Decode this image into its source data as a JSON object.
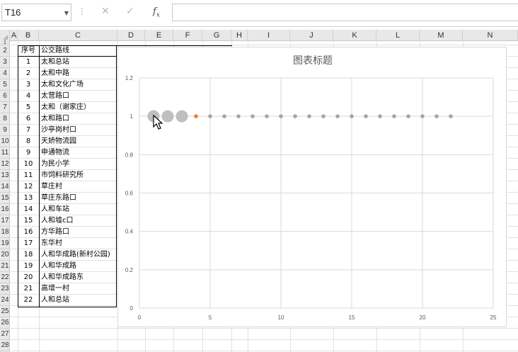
{
  "formula_bar": {
    "name_box": "T16",
    "cancel_icon": "✕",
    "enter_icon": "✓",
    "fx_label": "f",
    "fx_sub": "x",
    "formula": ""
  },
  "columns": [
    "A",
    "B",
    "C",
    "D",
    "E",
    "F",
    "G",
    "H",
    "I",
    "J",
    "K",
    "L",
    "M",
    "N"
  ],
  "rows": [
    "1",
    "2",
    "3",
    "4",
    "5",
    "6",
    "7",
    "8",
    "9",
    "10",
    "11",
    "12",
    "13",
    "14",
    "15",
    "16",
    "17",
    "18",
    "19",
    "20",
    "21",
    "22",
    "23",
    "24",
    "25",
    "26",
    "27",
    "28"
  ],
  "table": {
    "header": {
      "num": "序号",
      "name": "公交路线"
    },
    "rows": [
      {
        "num": "1",
        "name": "太和总站"
      },
      {
        "num": "2",
        "name": "太和中路"
      },
      {
        "num": "3",
        "name": "太和文化广场"
      },
      {
        "num": "4",
        "name": "太营路口"
      },
      {
        "num": "5",
        "name": "太和（谢家庄）"
      },
      {
        "num": "6",
        "name": "太和路口"
      },
      {
        "num": "7",
        "name": "沙亭岗村口"
      },
      {
        "num": "8",
        "name": "天娇物流园"
      },
      {
        "num": "9",
        "name": "申通物流"
      },
      {
        "num": "10",
        "name": "为民小学"
      },
      {
        "num": "11",
        "name": "市饲料研究所"
      },
      {
        "num": "12",
        "name": "草庄村"
      },
      {
        "num": "13",
        "name": "草庄东路口"
      },
      {
        "num": "14",
        "name": "人和车站"
      },
      {
        "num": "15",
        "name": "人和墟c口"
      },
      {
        "num": "16",
        "name": "方华路口"
      },
      {
        "num": "17",
        "name": "东华村"
      },
      {
        "num": "18",
        "name": "人和华成路(新村公园)"
      },
      {
        "num": "19",
        "name": "人和华成路"
      },
      {
        "num": "20",
        "name": "人和华成路东"
      },
      {
        "num": "21",
        "name": "高增一村"
      },
      {
        "num": "22",
        "name": "人和总站"
      }
    ]
  },
  "chart_data": {
    "type": "scatter",
    "title": "图表标题",
    "xlim": [
      0,
      25
    ],
    "ylim": [
      0,
      1.2
    ],
    "x_ticks": [
      "0",
      "5",
      "10",
      "15",
      "20",
      "25"
    ],
    "y_ticks": [
      "0",
      "0.2",
      "0.4",
      "0.6",
      "0.8",
      "1",
      "1.2"
    ],
    "grid": true,
    "points": [
      {
        "x": 1,
        "y": 1,
        "size": "large",
        "color": "#bfbfbf"
      },
      {
        "x": 2,
        "y": 1,
        "size": "large",
        "color": "#bfbfbf"
      },
      {
        "x": 3,
        "y": 1,
        "size": "large",
        "color": "#bfbfbf"
      },
      {
        "x": 4,
        "y": 1,
        "size": "small",
        "color": "#ed7d31"
      },
      {
        "x": 5,
        "y": 1,
        "size": "small",
        "color": "#a5a5a5"
      },
      {
        "x": 6,
        "y": 1,
        "size": "small",
        "color": "#a5a5a5"
      },
      {
        "x": 7,
        "y": 1,
        "size": "small",
        "color": "#a5a5a5"
      },
      {
        "x": 8,
        "y": 1,
        "size": "small",
        "color": "#a5a5a5"
      },
      {
        "x": 9,
        "y": 1,
        "size": "small",
        "color": "#a5a5a5"
      },
      {
        "x": 10,
        "y": 1,
        "size": "small",
        "color": "#a5a5a5"
      },
      {
        "x": 11,
        "y": 1,
        "size": "small",
        "color": "#a5a5a5"
      },
      {
        "x": 12,
        "y": 1,
        "size": "small",
        "color": "#a5a5a5"
      },
      {
        "x": 13,
        "y": 1,
        "size": "small",
        "color": "#a5a5a5"
      },
      {
        "x": 14,
        "y": 1,
        "size": "small",
        "color": "#a5a5a5"
      },
      {
        "x": 15,
        "y": 1,
        "size": "small",
        "color": "#a5a5a5"
      },
      {
        "x": 16,
        "y": 1,
        "size": "small",
        "color": "#a5a5a5"
      },
      {
        "x": 17,
        "y": 1,
        "size": "small",
        "color": "#a5a5a5"
      },
      {
        "x": 18,
        "y": 1,
        "size": "small",
        "color": "#a5a5a5"
      },
      {
        "x": 19,
        "y": 1,
        "size": "small",
        "color": "#a5a5a5"
      },
      {
        "x": 20,
        "y": 1,
        "size": "small",
        "color": "#a5a5a5"
      },
      {
        "x": 21,
        "y": 1,
        "size": "small",
        "color": "#a5a5a5"
      },
      {
        "x": 22,
        "y": 1,
        "size": "small",
        "color": "#a5a5a5"
      }
    ]
  }
}
